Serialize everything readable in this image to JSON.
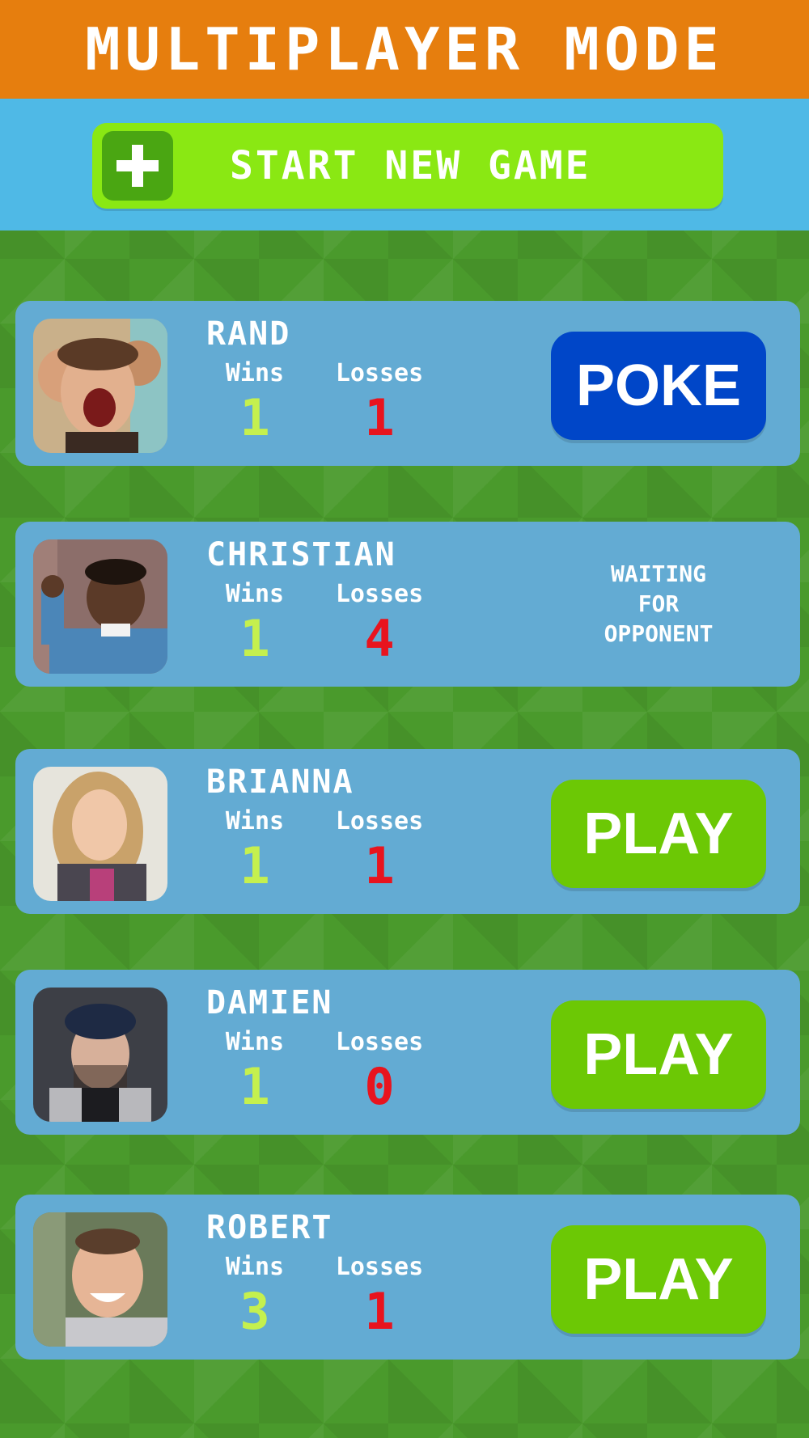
{
  "header": {
    "title": "MULTIPLAYER MODE"
  },
  "start_button": {
    "label": "START NEW GAME",
    "icon": "plus-icon"
  },
  "stats_labels": {
    "wins": "Wins",
    "losses": "Losses"
  },
  "colors": {
    "header_bg": "#e67e0e",
    "start_bar_bg": "#4fb9e6",
    "start_button_bg": "#8ae813",
    "card_bg": "#63abd3",
    "poke_button": "#0046c8",
    "play_button": "#6cc805",
    "wins_value": "#c5f04e",
    "losses_value": "#e8141e"
  },
  "players": [
    {
      "name": "RAND",
      "wins": "1",
      "losses": "1",
      "action": "POKE",
      "avatar": "avatar-group-selfie"
    },
    {
      "name": "CHRISTIAN",
      "wins": "1",
      "losses": "4",
      "status": "WAITING\nFOR\nOPPONENT",
      "avatar": "avatar-child"
    },
    {
      "name": "BRIANNA",
      "wins": "1",
      "losses": "1",
      "action": "PLAY",
      "avatar": "avatar-woman"
    },
    {
      "name": "DAMIEN",
      "wins": "1",
      "losses": "0",
      "action": "PLAY",
      "avatar": "avatar-man-cap"
    },
    {
      "name": "ROBERT",
      "wins": "3",
      "losses": "1",
      "action": "PLAY",
      "avatar": "avatar-man-smile"
    }
  ]
}
